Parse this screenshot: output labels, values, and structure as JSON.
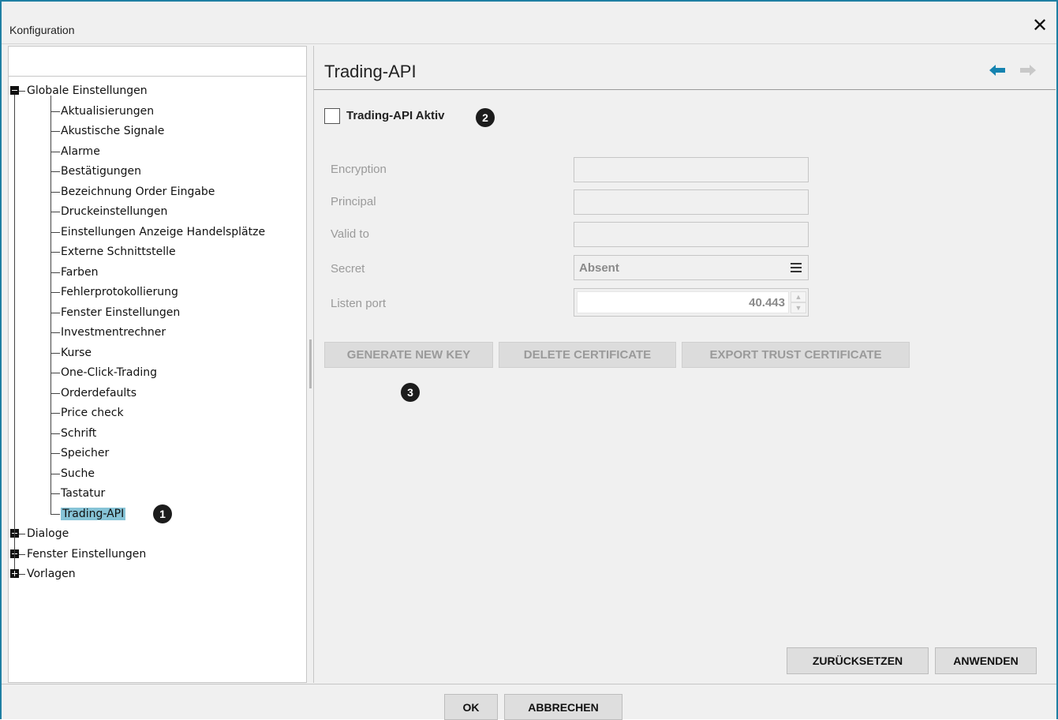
{
  "window": {
    "title": "Konfiguration",
    "close_glyph": "✕",
    "border_color": "#1f7fa3"
  },
  "tree": {
    "search_value": "",
    "root": {
      "label": "Globale Einstellungen",
      "expanded": true
    },
    "children": [
      "Aktualisierungen",
      "Akustische Signale",
      "Alarme",
      "Bestätigungen",
      "Bezeichnung Order Eingabe",
      "Druckeinstellungen",
      "Einstellungen Anzeige Handelsplätze",
      "Externe Schnittstelle",
      "Farben",
      "Fehlerprotokollierung",
      "Fenster Einstellungen",
      "Investmentrechner",
      "Kurse",
      "One-Click-Trading",
      "Orderdefaults",
      "Price check",
      "Schrift",
      "Speicher",
      "Suche",
      "Tastatur",
      "Trading-API"
    ],
    "selected": "Trading-API",
    "selected_color": "#86c3d6",
    "collapsed_roots": [
      "Dialoge",
      "Fenster Einstellungen",
      "Vorlagen"
    ]
  },
  "badges": {
    "one": "1",
    "two": "2",
    "three": "3"
  },
  "panel": {
    "title": "Trading-API",
    "back_icon_color": "#1583b0",
    "forward_icon_color": "#c8c8c8",
    "active_checkbox": {
      "label": "Trading-API Aktiv",
      "checked": false
    },
    "fields": {
      "encryption": {
        "label": "Encryption",
        "value": ""
      },
      "principal": {
        "label": "Principal",
        "value": ""
      },
      "valid_to": {
        "label": "Valid to",
        "value": ""
      },
      "secret": {
        "label": "Secret",
        "value": "Absent"
      },
      "listen_port": {
        "label": "Listen port",
        "value": "40.443"
      }
    },
    "buttons": {
      "generate": "GENERATE NEW KEY",
      "delete": "DELETE CERTIFICATE",
      "export": "EXPORT TRUST CERTIFICATE",
      "reset": "ZURÜCKSETZEN",
      "apply": "ANWENDEN"
    }
  },
  "footer": {
    "ok": "OK",
    "cancel": "ABBRECHEN"
  }
}
